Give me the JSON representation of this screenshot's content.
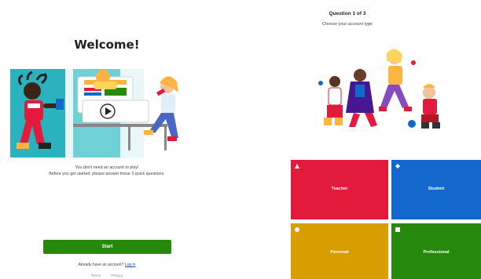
{
  "welcome": {
    "title": "Welcome!",
    "message_line1": "You don't need an account to play!",
    "message_line2": "Before you get started, please answer these 3 quick questions.",
    "start_label": "Start",
    "login_prefix": "Already have an account?",
    "login_label": "Log in",
    "footer": [
      "Terms",
      "Privacy"
    ]
  },
  "question": {
    "counter": "Question 1 of 3",
    "text": "Choose your account type",
    "answers": [
      {
        "label": "Teacher",
        "color": "#e21b3c",
        "shape": "triangle"
      },
      {
        "label": "Student",
        "color": "#1368ce",
        "shape": "diamond"
      },
      {
        "label": "Personal",
        "color": "#d89e00",
        "shape": "circle"
      },
      {
        "label": "Professional",
        "color": "#26890c",
        "shape": "square"
      }
    ]
  },
  "colors": {
    "start_button": "#26890c",
    "link": "#1a4fa3"
  }
}
